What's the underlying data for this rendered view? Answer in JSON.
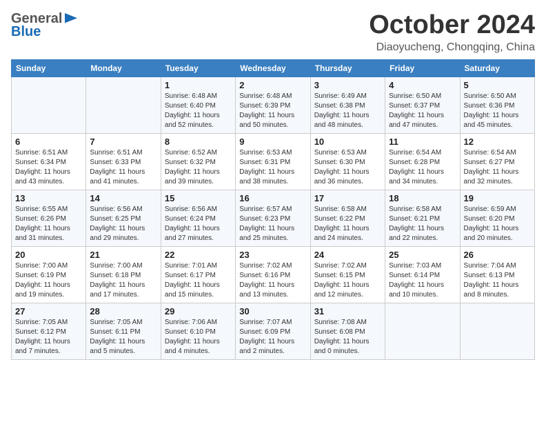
{
  "header": {
    "logo_general": "General",
    "logo_blue": "Blue",
    "month": "October 2024",
    "location": "Diaoyucheng, Chongqing, China"
  },
  "weekdays": [
    "Sunday",
    "Monday",
    "Tuesday",
    "Wednesday",
    "Thursday",
    "Friday",
    "Saturday"
  ],
  "weeks": [
    [
      {
        "day": "",
        "info": ""
      },
      {
        "day": "",
        "info": ""
      },
      {
        "day": "1",
        "info": "Sunrise: 6:48 AM\nSunset: 6:40 PM\nDaylight: 11 hours and 52 minutes."
      },
      {
        "day": "2",
        "info": "Sunrise: 6:48 AM\nSunset: 6:39 PM\nDaylight: 11 hours and 50 minutes."
      },
      {
        "day": "3",
        "info": "Sunrise: 6:49 AM\nSunset: 6:38 PM\nDaylight: 11 hours and 48 minutes."
      },
      {
        "day": "4",
        "info": "Sunrise: 6:50 AM\nSunset: 6:37 PM\nDaylight: 11 hours and 47 minutes."
      },
      {
        "day": "5",
        "info": "Sunrise: 6:50 AM\nSunset: 6:36 PM\nDaylight: 11 hours and 45 minutes."
      }
    ],
    [
      {
        "day": "6",
        "info": "Sunrise: 6:51 AM\nSunset: 6:34 PM\nDaylight: 11 hours and 43 minutes."
      },
      {
        "day": "7",
        "info": "Sunrise: 6:51 AM\nSunset: 6:33 PM\nDaylight: 11 hours and 41 minutes."
      },
      {
        "day": "8",
        "info": "Sunrise: 6:52 AM\nSunset: 6:32 PM\nDaylight: 11 hours and 39 minutes."
      },
      {
        "day": "9",
        "info": "Sunrise: 6:53 AM\nSunset: 6:31 PM\nDaylight: 11 hours and 38 minutes."
      },
      {
        "day": "10",
        "info": "Sunrise: 6:53 AM\nSunset: 6:30 PM\nDaylight: 11 hours and 36 minutes."
      },
      {
        "day": "11",
        "info": "Sunrise: 6:54 AM\nSunset: 6:28 PM\nDaylight: 11 hours and 34 minutes."
      },
      {
        "day": "12",
        "info": "Sunrise: 6:54 AM\nSunset: 6:27 PM\nDaylight: 11 hours and 32 minutes."
      }
    ],
    [
      {
        "day": "13",
        "info": "Sunrise: 6:55 AM\nSunset: 6:26 PM\nDaylight: 11 hours and 31 minutes."
      },
      {
        "day": "14",
        "info": "Sunrise: 6:56 AM\nSunset: 6:25 PM\nDaylight: 11 hours and 29 minutes."
      },
      {
        "day": "15",
        "info": "Sunrise: 6:56 AM\nSunset: 6:24 PM\nDaylight: 11 hours and 27 minutes."
      },
      {
        "day": "16",
        "info": "Sunrise: 6:57 AM\nSunset: 6:23 PM\nDaylight: 11 hours and 25 minutes."
      },
      {
        "day": "17",
        "info": "Sunrise: 6:58 AM\nSunset: 6:22 PM\nDaylight: 11 hours and 24 minutes."
      },
      {
        "day": "18",
        "info": "Sunrise: 6:58 AM\nSunset: 6:21 PM\nDaylight: 11 hours and 22 minutes."
      },
      {
        "day": "19",
        "info": "Sunrise: 6:59 AM\nSunset: 6:20 PM\nDaylight: 11 hours and 20 minutes."
      }
    ],
    [
      {
        "day": "20",
        "info": "Sunrise: 7:00 AM\nSunset: 6:19 PM\nDaylight: 11 hours and 19 minutes."
      },
      {
        "day": "21",
        "info": "Sunrise: 7:00 AM\nSunset: 6:18 PM\nDaylight: 11 hours and 17 minutes."
      },
      {
        "day": "22",
        "info": "Sunrise: 7:01 AM\nSunset: 6:17 PM\nDaylight: 11 hours and 15 minutes."
      },
      {
        "day": "23",
        "info": "Sunrise: 7:02 AM\nSunset: 6:16 PM\nDaylight: 11 hours and 13 minutes."
      },
      {
        "day": "24",
        "info": "Sunrise: 7:02 AM\nSunset: 6:15 PM\nDaylight: 11 hours and 12 minutes."
      },
      {
        "day": "25",
        "info": "Sunrise: 7:03 AM\nSunset: 6:14 PM\nDaylight: 11 hours and 10 minutes."
      },
      {
        "day": "26",
        "info": "Sunrise: 7:04 AM\nSunset: 6:13 PM\nDaylight: 11 hours and 8 minutes."
      }
    ],
    [
      {
        "day": "27",
        "info": "Sunrise: 7:05 AM\nSunset: 6:12 PM\nDaylight: 11 hours and 7 minutes."
      },
      {
        "day": "28",
        "info": "Sunrise: 7:05 AM\nSunset: 6:11 PM\nDaylight: 11 hours and 5 minutes."
      },
      {
        "day": "29",
        "info": "Sunrise: 7:06 AM\nSunset: 6:10 PM\nDaylight: 11 hours and 4 minutes."
      },
      {
        "day": "30",
        "info": "Sunrise: 7:07 AM\nSunset: 6:09 PM\nDaylight: 11 hours and 2 minutes."
      },
      {
        "day": "31",
        "info": "Sunrise: 7:08 AM\nSunset: 6:08 PM\nDaylight: 11 hours and 0 minutes."
      },
      {
        "day": "",
        "info": ""
      },
      {
        "day": "",
        "info": ""
      }
    ]
  ]
}
